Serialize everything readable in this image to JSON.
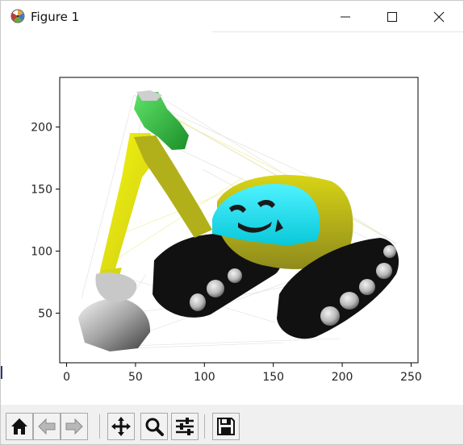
{
  "window": {
    "title": "Figure 1",
    "app_icon": "matplotlib-icon",
    "controls": [
      "minimize-icon",
      "maximize-icon",
      "close-icon"
    ]
  },
  "chart_data": {
    "type": "image",
    "title": "",
    "xlabel": "",
    "ylabel": "",
    "xlim": [
      -5,
      255
    ],
    "ylim": [
      10,
      240
    ],
    "x_ticks": [
      0,
      50,
      100,
      150,
      200,
      250
    ],
    "y_ticks": [
      50,
      100,
      150,
      200
    ],
    "x_tick_labels": [
      "0",
      "50",
      "100",
      "150",
      "200",
      "250"
    ],
    "y_tick_labels": [
      "50",
      "100",
      "150",
      "200"
    ],
    "grid": false,
    "colors": {
      "arm_yellow": "#e7e70a",
      "arm_olive": "#a9a91c",
      "cab_cyan": "#1ae0ef",
      "gripper_green": "#2fbf3a",
      "tracks_black": "#141414",
      "bucket_gray": "#9a9a9a"
    }
  },
  "toolbar": {
    "buttons": [
      {
        "icon": "home-icon",
        "name": "home-button"
      },
      {
        "icon": "back-arrow-icon",
        "name": "back-button"
      },
      {
        "icon": "forward-arrow-icon",
        "name": "forward-button"
      },
      {
        "icon": "pan-icon",
        "name": "pan-button"
      },
      {
        "icon": "zoom-icon",
        "name": "zoom-button"
      },
      {
        "icon": "subplots-icon",
        "name": "configure-subplots-button"
      },
      {
        "icon": "save-icon",
        "name": "save-button"
      }
    ]
  }
}
